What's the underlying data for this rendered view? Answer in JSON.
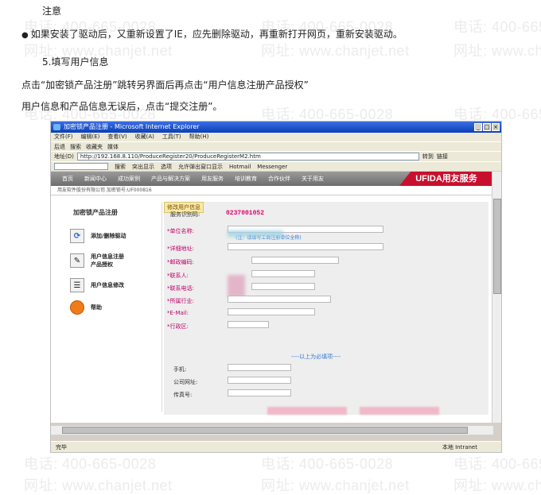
{
  "watermark": {
    "phone": "电话: 400-665-0028",
    "site": "网址: www.chanjet.net"
  },
  "doc": {
    "note_heading": "注意",
    "bullet": "如果安装了驱动后，又重新设置了IE，应先删除驱动，再重新打开网页，重新安装驱动。",
    "step_heading": "5.填写用户信息",
    "para1": "点击“加密锁产品注册”跳转另界面后再点击“用户信息注册产品授权”",
    "para2": "用户信息和产品信息无误后，点击“提交注册”。"
  },
  "screenshot": {
    "window_title": "加密锁产品注册 - Microsoft Internet Explorer",
    "menu": [
      "文件(F)",
      "编辑(E)",
      "查看(V)",
      "收藏(A)",
      "工具(T)",
      "帮助(H)"
    ],
    "toolbar": [
      "后退",
      "搜索",
      "收藏夹",
      "媒体"
    ],
    "address_label": "地址(D)",
    "url": "http://192.168.8.110/ProduceRegister20/ProduceRegisterM2.htm",
    "go": "转到",
    "links": "链接",
    "linkbar": [
      "搜索",
      "突出显示",
      "选项",
      "允许弹出窗口显示",
      "Hotmail",
      "Messenger"
    ],
    "sitenav": [
      "首页",
      "新闻中心",
      "成功案例",
      "产品与解决方案",
      "用友服务",
      "培训教育",
      "合作伙伴",
      "关于用友"
    ],
    "brand": "UFIDA用友服务",
    "subhead": "用友软件股份有限公司  加密锁号:UF000816",
    "left_title": "加密锁产品注册",
    "left_items": [
      {
        "label": "添加/删除驱动",
        "icon": "refresh-icon"
      },
      {
        "label": "用户信息注册\n产品授权",
        "icon": "pen-icon"
      },
      {
        "label": "用户信息修改",
        "icon": "form-icon"
      },
      {
        "label": "帮助",
        "icon": "help-icon"
      }
    ],
    "form_tab": "修改用户信息",
    "service_label": "服务识别码:",
    "service_id": "0237001052",
    "fields": [
      "*单位名称:",
      "*详细地址:",
      "*邮政编码:",
      "*联系人:",
      "*联系电话:",
      "*所属行业:",
      "*E-Mail:",
      "*行政区:"
    ],
    "hint": "(注：请填写工商注册单位全称)",
    "separator": "----以上为必填项----",
    "optional_fields": [
      "手机:",
      "公司网址:",
      "传真号:"
    ],
    "status_left": "完毕",
    "status_right": "本地 Intranet"
  }
}
